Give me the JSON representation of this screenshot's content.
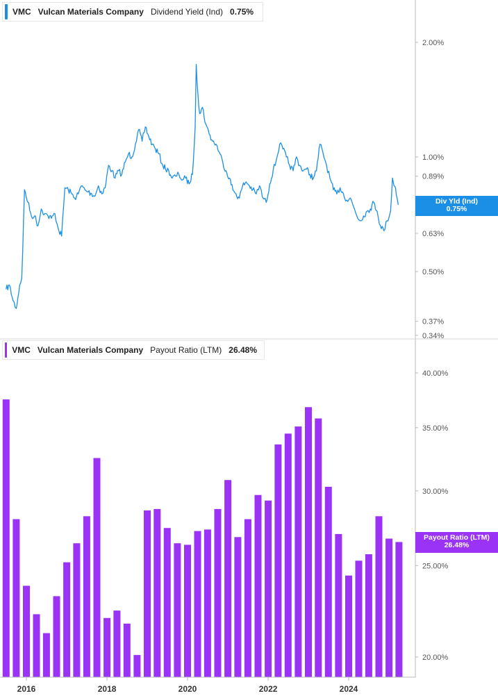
{
  "colors": {
    "yield": "#1b8fe6",
    "payout": "#9a33f5",
    "axis": "#bbbbbb"
  },
  "top_panel": {
    "legend": {
      "ticker": "VMC",
      "company": "Vulcan Materials Company",
      "metric": "Dividend Yield (Ind)",
      "value": "0.75%"
    },
    "tag": {
      "label": "Div Yld (Ind)",
      "value": "0.75%"
    }
  },
  "bottom_panel": {
    "legend": {
      "ticker": "VMC",
      "company": "Vulcan Materials Company",
      "metric": "Payout Ratio (LTM)",
      "value": "26.48%"
    },
    "tag": {
      "label": "Payout Ratio (LTM)",
      "value": "26.48%"
    }
  },
  "chart_data": [
    {
      "type": "line",
      "title": "",
      "series": [
        {
          "name": "Dividend Yield (Ind)",
          "last_value": "0.75%"
        }
      ],
      "y_scale": "log",
      "ylim": [
        0.33,
        2.3
      ],
      "y_ticks": [
        {
          "value": 2.0,
          "label": "2.00%"
        },
        {
          "value": 1.0,
          "label": "1.00%"
        },
        {
          "value": 0.89,
          "label": "0.89%"
        },
        {
          "value": 0.63,
          "label": "0.63%"
        },
        {
          "value": 0.5,
          "label": "0.50%"
        },
        {
          "value": 0.37,
          "label": "0.37%"
        },
        {
          "value": 0.34,
          "label": "0.34%"
        }
      ],
      "x_ticks": [
        "2016",
        "2018",
        "2020",
        "2022",
        "2024"
      ],
      "points": [
        [
          "2015-07-01",
          0.45
        ],
        [
          "2015-08-01",
          0.46
        ],
        [
          "2015-09-01",
          0.42
        ],
        [
          "2015-10-01",
          0.4
        ],
        [
          "2015-11-01",
          0.46
        ],
        [
          "2015-11-20",
          0.48
        ],
        [
          "2015-12-15",
          0.82
        ],
        [
          "2016-01-15",
          0.76
        ],
        [
          "2016-02-15",
          0.7
        ],
        [
          "2016-03-15",
          0.7
        ],
        [
          "2016-04-15",
          0.66
        ],
        [
          "2016-05-15",
          0.73
        ],
        [
          "2016-06-15",
          0.71
        ],
        [
          "2016-07-15",
          0.7
        ],
        [
          "2016-08-15",
          0.69
        ],
        [
          "2016-09-15",
          0.71
        ],
        [
          "2016-10-15",
          0.65
        ],
        [
          "2016-11-15",
          0.62
        ],
        [
          "2016-12-15",
          0.83
        ],
        [
          "2017-01-15",
          0.82
        ],
        [
          "2017-02-15",
          0.8
        ],
        [
          "2017-03-15",
          0.78
        ],
        [
          "2017-04-15",
          0.8
        ],
        [
          "2017-05-15",
          0.84
        ],
        [
          "2017-06-15",
          0.82
        ],
        [
          "2017-07-15",
          0.81
        ],
        [
          "2017-08-15",
          0.8
        ],
        [
          "2017-09-15",
          0.79
        ],
        [
          "2017-10-15",
          0.84
        ],
        [
          "2017-11-15",
          0.8
        ],
        [
          "2017-12-15",
          0.83
        ],
        [
          "2018-01-15",
          0.95
        ],
        [
          "2018-02-15",
          0.92
        ],
        [
          "2018-03-15",
          0.88
        ],
        [
          "2018-04-15",
          0.92
        ],
        [
          "2018-05-15",
          0.9
        ],
        [
          "2018-06-15",
          0.97
        ],
        [
          "2018-07-15",
          1.02
        ],
        [
          "2018-08-15",
          1.0
        ],
        [
          "2018-09-15",
          1.08
        ],
        [
          "2018-10-15",
          1.18
        ],
        [
          "2018-11-15",
          1.1
        ],
        [
          "2018-12-15",
          1.2
        ],
        [
          "2019-01-15",
          1.13
        ],
        [
          "2019-02-15",
          1.08
        ],
        [
          "2019-03-15",
          1.05
        ],
        [
          "2019-04-15",
          1.02
        ],
        [
          "2019-05-15",
          0.96
        ],
        [
          "2019-06-15",
          0.93
        ],
        [
          "2019-07-15",
          0.92
        ],
        [
          "2019-08-15",
          0.88
        ],
        [
          "2019-09-15",
          0.89
        ],
        [
          "2019-10-15",
          0.9
        ],
        [
          "2019-11-15",
          0.87
        ],
        [
          "2019-12-15",
          0.88
        ],
        [
          "2020-01-15",
          0.85
        ],
        [
          "2020-02-15",
          0.9
        ],
        [
          "2020-03-10",
          1.2
        ],
        [
          "2020-03-20",
          1.75
        ],
        [
          "2020-04-05",
          1.45
        ],
        [
          "2020-04-20",
          1.3
        ],
        [
          "2020-05-15",
          1.35
        ],
        [
          "2020-06-15",
          1.22
        ],
        [
          "2020-07-15",
          1.15
        ],
        [
          "2020-08-15",
          1.1
        ],
        [
          "2020-09-15",
          1.08
        ],
        [
          "2020-10-15",
          1.03
        ],
        [
          "2020-11-15",
          0.97
        ],
        [
          "2020-12-15",
          0.92
        ],
        [
          "2021-01-15",
          0.88
        ],
        [
          "2021-02-15",
          0.82
        ],
        [
          "2021-03-15",
          0.8
        ],
        [
          "2021-04-15",
          0.78
        ],
        [
          "2021-05-15",
          0.84
        ],
        [
          "2021-06-15",
          0.86
        ],
        [
          "2021-07-15",
          0.84
        ],
        [
          "2021-08-15",
          0.82
        ],
        [
          "2021-09-15",
          0.8
        ],
        [
          "2021-10-15",
          0.84
        ],
        [
          "2021-11-15",
          0.78
        ],
        [
          "2021-12-15",
          0.76
        ],
        [
          "2022-01-15",
          0.85
        ],
        [
          "2022-02-15",
          0.92
        ],
        [
          "2022-03-15",
          0.98
        ],
        [
          "2022-04-15",
          1.08
        ],
        [
          "2022-05-15",
          1.05
        ],
        [
          "2022-06-15",
          1.0
        ],
        [
          "2022-07-15",
          0.95
        ],
        [
          "2022-08-15",
          0.92
        ],
        [
          "2022-09-15",
          1.0
        ],
        [
          "2022-10-15",
          0.95
        ],
        [
          "2022-11-15",
          0.92
        ],
        [
          "2022-12-15",
          0.93
        ],
        [
          "2023-01-15",
          0.9
        ],
        [
          "2023-02-15",
          0.88
        ],
        [
          "2023-03-15",
          0.92
        ],
        [
          "2023-04-15",
          1.08
        ],
        [
          "2023-05-15",
          1.02
        ],
        [
          "2023-06-15",
          0.95
        ],
        [
          "2023-07-15",
          0.88
        ],
        [
          "2023-08-15",
          0.82
        ],
        [
          "2023-09-15",
          0.8
        ],
        [
          "2023-10-15",
          0.83
        ],
        [
          "2023-11-15",
          0.8
        ],
        [
          "2023-12-15",
          0.77
        ],
        [
          "2024-01-15",
          0.78
        ],
        [
          "2024-02-15",
          0.74
        ],
        [
          "2024-03-15",
          0.7
        ],
        [
          "2024-04-15",
          0.68
        ],
        [
          "2024-05-15",
          0.7
        ],
        [
          "2024-06-15",
          0.72
        ],
        [
          "2024-07-15",
          0.73
        ],
        [
          "2024-08-15",
          0.76
        ],
        [
          "2024-09-15",
          0.72
        ],
        [
          "2024-10-15",
          0.66
        ],
        [
          "2024-11-15",
          0.64
        ],
        [
          "2024-12-15",
          0.68
        ],
        [
          "2025-01-15",
          0.72
        ],
        [
          "2025-02-01",
          0.88
        ],
        [
          "2025-02-15",
          0.84
        ],
        [
          "2025-03-01",
          0.83
        ],
        [
          "2025-03-15",
          0.78
        ],
        [
          "2025-03-25",
          0.75
        ]
      ]
    },
    {
      "type": "bar",
      "title": "",
      "series": [
        {
          "name": "Payout Ratio (LTM)",
          "last_value": "26.48%"
        }
      ],
      "y_scale": "log",
      "ylim": [
        19.5,
        42.0
      ],
      "y_ticks": [
        {
          "value": 40,
          "label": "40.00%"
        },
        {
          "value": 35,
          "label": "35.00%"
        },
        {
          "value": 30,
          "label": "30.00%"
        },
        {
          "value": 25,
          "label": "25.00%"
        },
        {
          "value": 20,
          "label": "20.00%"
        }
      ],
      "x_ticks": [
        "2016",
        "2018",
        "2020",
        "2022",
        "2024"
      ],
      "bars": [
        {
          "date": "2015-07-01",
          "value": 37.5
        },
        {
          "date": "2015-10-01",
          "value": 28.0
        },
        {
          "date": "2016-01-01",
          "value": 23.8
        },
        {
          "date": "2016-04-01",
          "value": 22.2
        },
        {
          "date": "2016-07-01",
          "value": 21.2
        },
        {
          "date": "2016-10-01",
          "value": 23.2
        },
        {
          "date": "2017-01-01",
          "value": 25.2
        },
        {
          "date": "2017-04-01",
          "value": 26.4
        },
        {
          "date": "2017-07-01",
          "value": 28.2
        },
        {
          "date": "2017-10-01",
          "value": 32.5
        },
        {
          "date": "2018-01-01",
          "value": 22.0
        },
        {
          "date": "2018-04-01",
          "value": 22.4
        },
        {
          "date": "2018-07-01",
          "value": 21.7
        },
        {
          "date": "2018-10-01",
          "value": 20.1
        },
        {
          "date": "2019-01-01",
          "value": 28.6
        },
        {
          "date": "2019-04-01",
          "value": 28.7
        },
        {
          "date": "2019-07-01",
          "value": 27.4
        },
        {
          "date": "2019-10-01",
          "value": 26.4
        },
        {
          "date": "2020-01-01",
          "value": 26.3
        },
        {
          "date": "2020-04-01",
          "value": 27.2
        },
        {
          "date": "2020-07-01",
          "value": 27.3
        },
        {
          "date": "2020-10-01",
          "value": 28.7
        },
        {
          "date": "2021-01-01",
          "value": 30.8
        },
        {
          "date": "2021-04-01",
          "value": 26.8
        },
        {
          "date": "2021-07-01",
          "value": 28.0
        },
        {
          "date": "2021-10-01",
          "value": 29.7
        },
        {
          "date": "2022-01-01",
          "value": 29.3
        },
        {
          "date": "2022-04-01",
          "value": 33.6
        },
        {
          "date": "2022-07-01",
          "value": 34.5
        },
        {
          "date": "2022-10-01",
          "value": 35.1
        },
        {
          "date": "2023-01-01",
          "value": 36.8
        },
        {
          "date": "2023-04-01",
          "value": 35.8
        },
        {
          "date": "2023-07-01",
          "value": 30.3
        },
        {
          "date": "2023-10-01",
          "value": 27.0
        },
        {
          "date": "2024-01-01",
          "value": 24.4
        },
        {
          "date": "2024-04-01",
          "value": 25.3
        },
        {
          "date": "2024-07-01",
          "value": 25.7
        },
        {
          "date": "2024-10-01",
          "value": 28.2
        },
        {
          "date": "2025-01-01",
          "value": 26.7
        },
        {
          "date": "2025-04-01",
          "value": 26.48
        }
      ]
    }
  ]
}
